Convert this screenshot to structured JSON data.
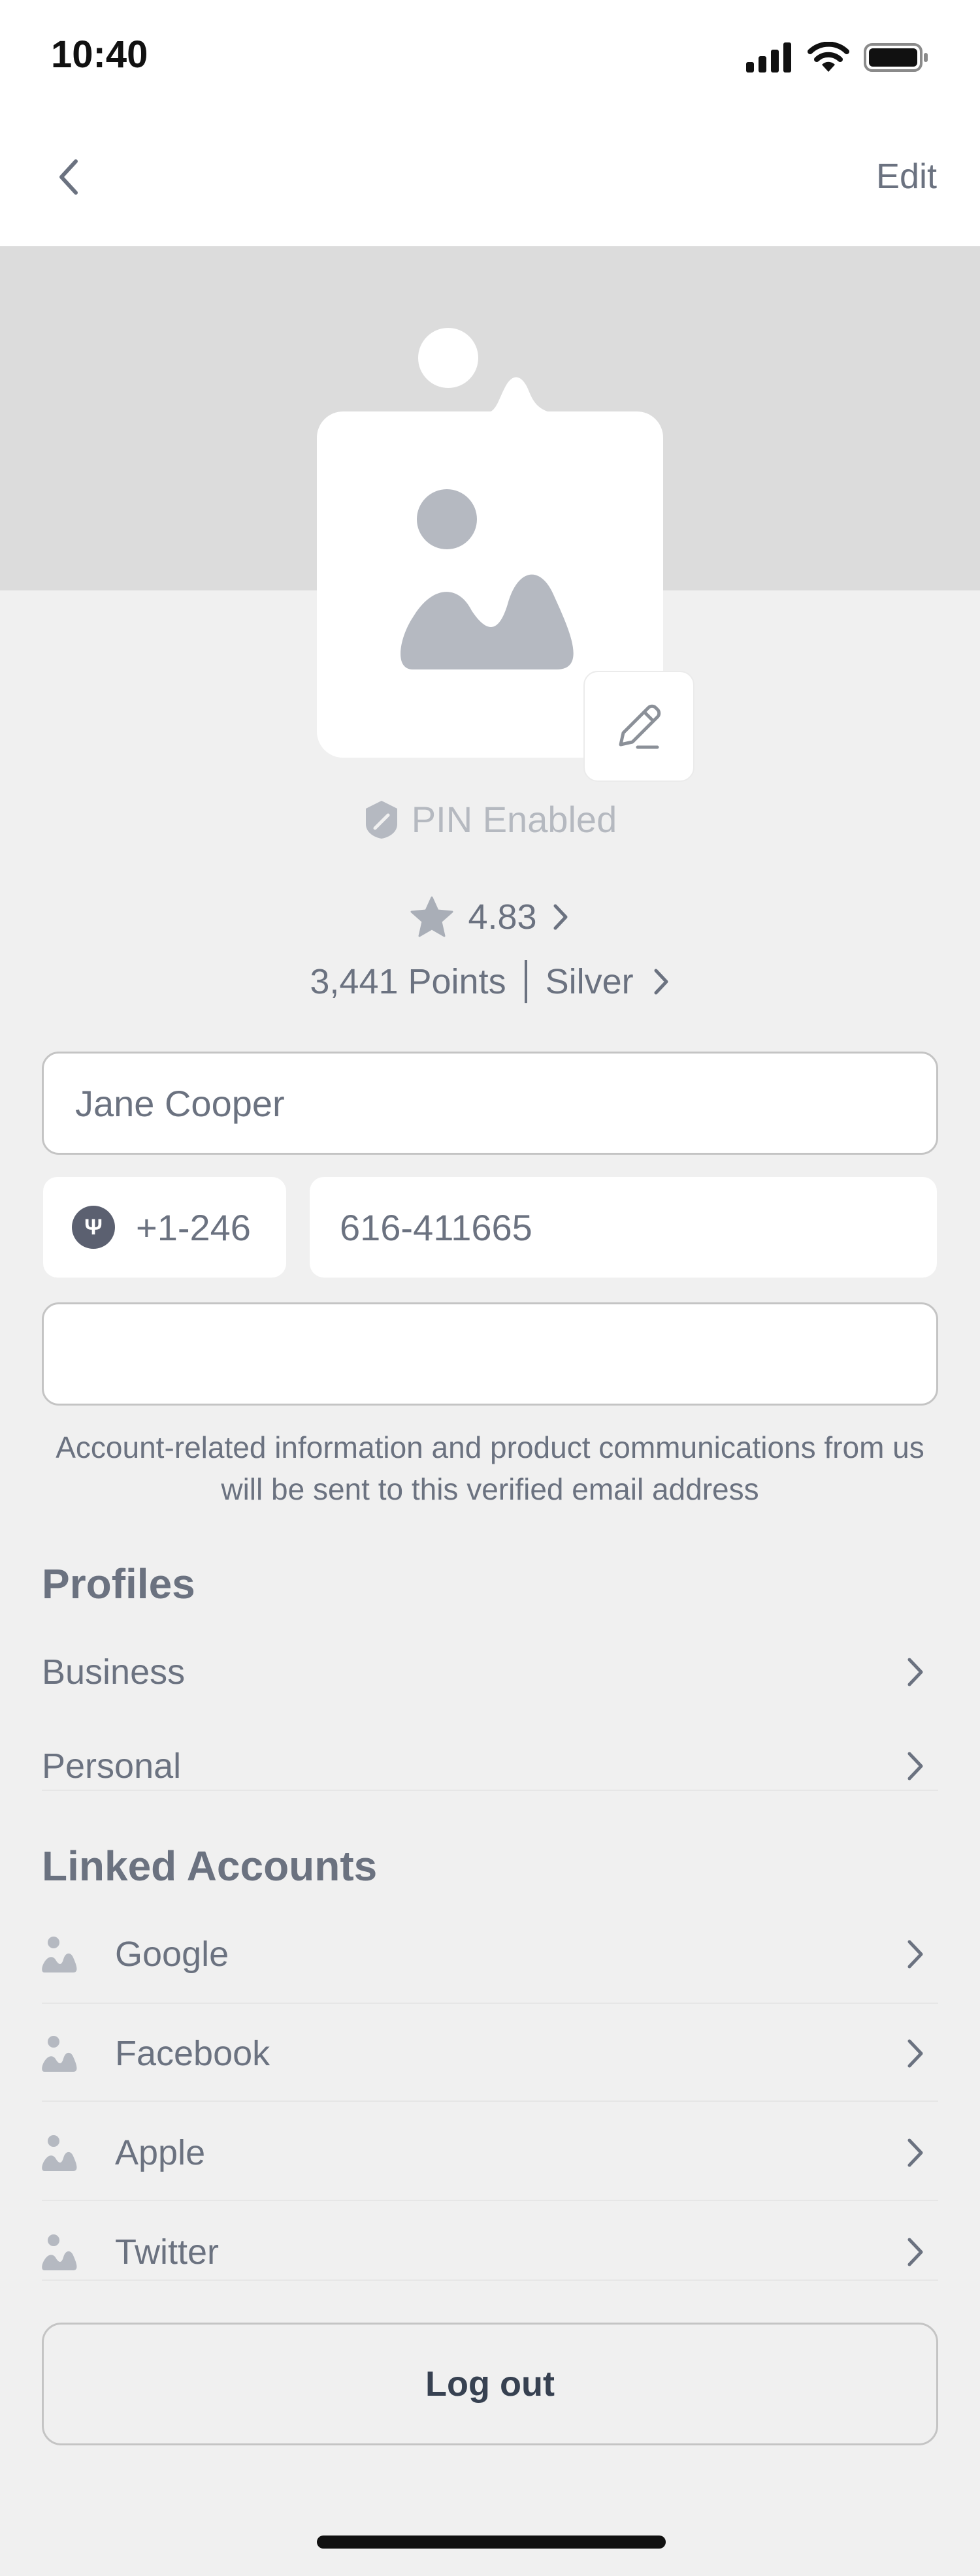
{
  "status_bar": {
    "time": "10:40"
  },
  "nav": {
    "edit_label": "Edit"
  },
  "profile": {
    "pin_status": "PIN Enabled",
    "rating": "4.83",
    "points": "3,441 Points",
    "tier": "Silver"
  },
  "form": {
    "name_value": "Jane Cooper",
    "country_code": "+1-246",
    "phone_value": "616-411665",
    "email_value": "",
    "email_note": "Account-related information and product communications from us will be sent to this verified email address"
  },
  "profiles": {
    "title": "Profiles",
    "items": [
      {
        "label": "Business"
      },
      {
        "label": "Personal"
      }
    ]
  },
  "linked_accounts": {
    "title": "Linked Accounts",
    "items": [
      {
        "label": "Google",
        "icon": "image-placeholder-icon"
      },
      {
        "label": "Facebook",
        "icon": "image-placeholder-icon"
      },
      {
        "label": "Apple",
        "icon": "image-placeholder-icon"
      },
      {
        "label": "Twitter",
        "icon": "image-placeholder-icon"
      }
    ]
  },
  "logout_label": "Log out",
  "colors": {
    "background": "#f0f0f0",
    "banner": "#dcdcdc",
    "text_muted": "#6b7280",
    "placeholder_icon": "#b5b9c1",
    "border": "#c4c4c4"
  }
}
